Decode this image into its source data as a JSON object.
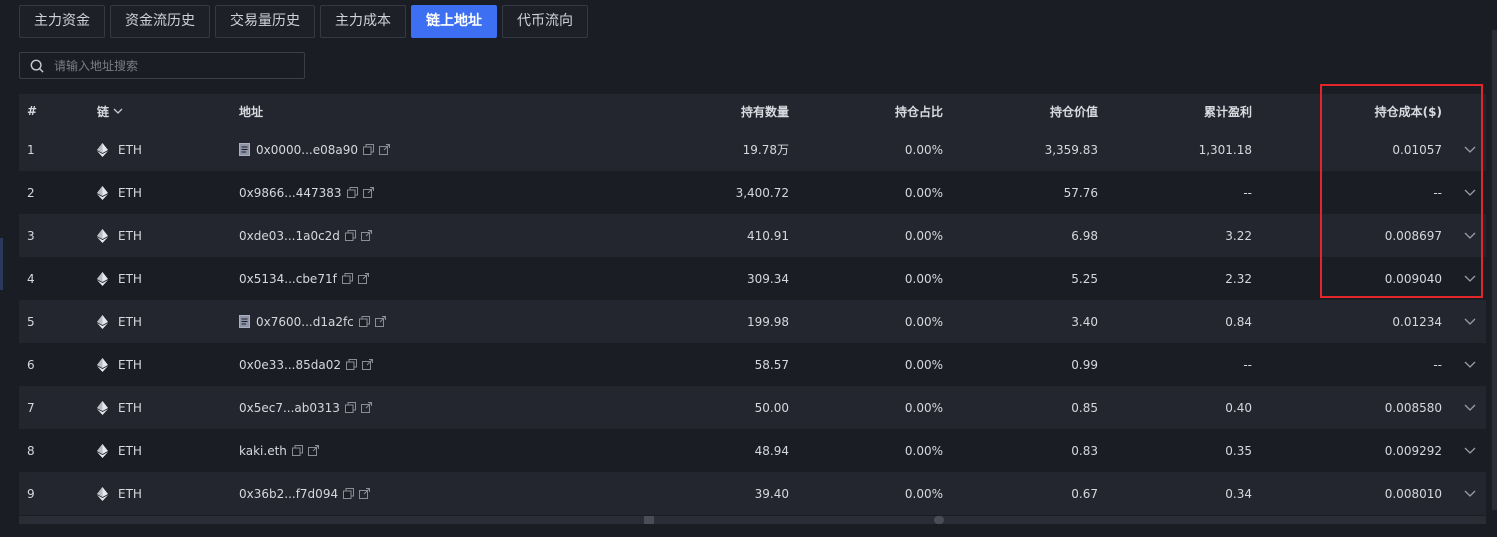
{
  "tabs": [
    {
      "label": "主力资金",
      "active": false
    },
    {
      "label": "资金流历史",
      "active": false
    },
    {
      "label": "交易量历史",
      "active": false
    },
    {
      "label": "主力成本",
      "active": false
    },
    {
      "label": "链上地址",
      "active": true
    },
    {
      "label": "代币流向",
      "active": false
    }
  ],
  "search": {
    "placeholder": "请输入地址搜索",
    "value": ""
  },
  "columns": {
    "index": "#",
    "chain": "链",
    "address": "地址",
    "amount": "持有数量",
    "ratio": "持仓占比",
    "value": "持仓价值",
    "pnl": "累计盈利",
    "cost": "持仓成本($)"
  },
  "rows": [
    {
      "index": "1",
      "chain": "ETH",
      "contract": true,
      "address": "0x0000...e08a90",
      "amount": "19.78万",
      "ratio": "0.00%",
      "value": "3,359.83",
      "pnl": "1,301.18",
      "cost": "0.01057"
    },
    {
      "index": "2",
      "chain": "ETH",
      "contract": false,
      "address": "0x9866...447383",
      "amount": "3,400.72",
      "ratio": "0.00%",
      "value": "57.76",
      "pnl": "--",
      "cost": "--"
    },
    {
      "index": "3",
      "chain": "ETH",
      "contract": false,
      "address": "0xde03...1a0c2d",
      "amount": "410.91",
      "ratio": "0.00%",
      "value": "6.98",
      "pnl": "3.22",
      "cost": "0.008697"
    },
    {
      "index": "4",
      "chain": "ETH",
      "contract": false,
      "address": "0x5134...cbe71f",
      "amount": "309.34",
      "ratio": "0.00%",
      "value": "5.25",
      "pnl": "2.32",
      "cost": "0.009040"
    },
    {
      "index": "5",
      "chain": "ETH",
      "contract": true,
      "address": "0x7600...d1a2fc",
      "amount": "199.98",
      "ratio": "0.00%",
      "value": "3.40",
      "pnl": "0.84",
      "cost": "0.01234"
    },
    {
      "index": "6",
      "chain": "ETH",
      "contract": false,
      "address": "0x0e33...85da02",
      "amount": "58.57",
      "ratio": "0.00%",
      "value": "0.99",
      "pnl": "--",
      "cost": "--"
    },
    {
      "index": "7",
      "chain": "ETH",
      "contract": false,
      "address": "0x5ec7...ab0313",
      "amount": "50.00",
      "ratio": "0.00%",
      "value": "0.85",
      "pnl": "0.40",
      "cost": "0.008580"
    },
    {
      "index": "8",
      "chain": "ETH",
      "contract": false,
      "address": "kaki.eth",
      "amount": "48.94",
      "ratio": "0.00%",
      "value": "0.83",
      "pnl": "0.35",
      "cost": "0.009292"
    },
    {
      "index": "9",
      "chain": "ETH",
      "contract": false,
      "address": "0x36b2...f7d094",
      "amount": "39.40",
      "ratio": "0.00%",
      "value": "0.67",
      "pnl": "0.34",
      "cost": "0.008010"
    }
  ],
  "colors": {
    "accent": "#3c6ff2",
    "highlight": "#e2262a",
    "background": "#1b1d24"
  },
  "icons": {
    "chain": "eth-icon",
    "contract": "doc-icon",
    "copy": "copy-icon",
    "link": "link-icon",
    "expand": "chevron-down-icon",
    "search": "search-icon"
  }
}
